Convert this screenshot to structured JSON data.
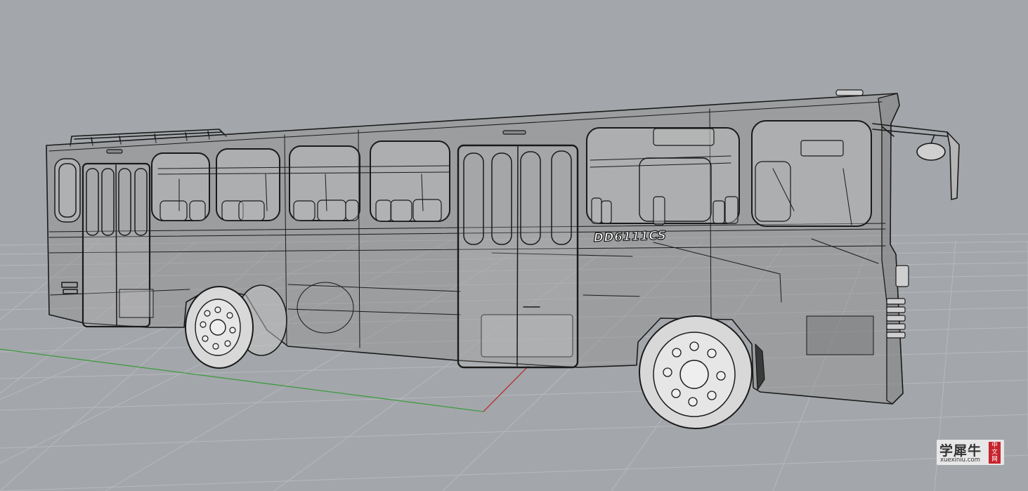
{
  "viewport": {
    "background_color": "#a3a7ab",
    "grid_color": "#b6b9bc",
    "x_axis_color": "#b83232",
    "y_axis_color": "#3f9a3f"
  },
  "model": {
    "bus_label": "DD6111CS",
    "shell_color": "#8e8e8e",
    "edge_color": "#1a1a1a"
  },
  "watermark": {
    "chinese_text": "学犀牛",
    "url_text": "xuexiniu.com",
    "badge_text": "中文网",
    "badge_color": "#c8232c"
  }
}
